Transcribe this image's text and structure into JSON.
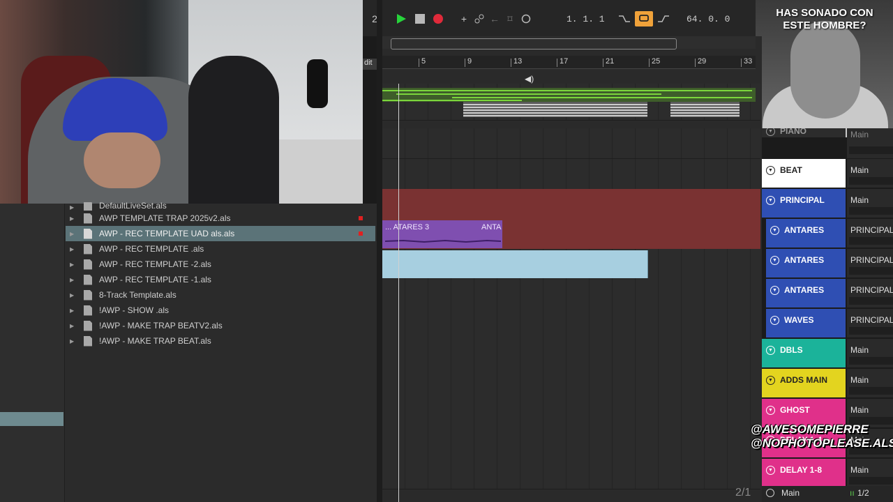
{
  "overlay": {
    "reaction_caption": "HAS SONADO CON ESTE HOMBRE?",
    "handle_1": "@AWESOMEPIERRE",
    "handle_2": "@NOPHOTOPLEASE.ALS"
  },
  "transport": {
    "track_num": "2",
    "position": "1.  1.  1",
    "loop_length": "64.  0.  0",
    "edit_tab": "dit"
  },
  "ruler": {
    "bars": [
      "5",
      "9",
      "13",
      "17",
      "21",
      "25",
      "29",
      "33"
    ]
  },
  "browser": {
    "files": [
      {
        "name": "DefaultLiveSet.als",
        "selected": false,
        "modified": false
      },
      {
        "name": "AWP TEMPLATE TRAP 2025v2.als",
        "selected": false,
        "modified": true
      },
      {
        "name": "AWP - REC TEMPLATE UAD als.als",
        "selected": true,
        "modified": true
      },
      {
        "name": "AWP - REC TEMPLATE .als",
        "selected": false,
        "modified": false
      },
      {
        "name": "AWP - REC TEMPLATE -2.als",
        "selected": false,
        "modified": false
      },
      {
        "name": "AWP - REC TEMPLATE -1.als",
        "selected": false,
        "modified": false
      },
      {
        "name": "8-Track Template.als",
        "selected": false,
        "modified": false
      },
      {
        "name": "!AWP - SHOW .als",
        "selected": false,
        "modified": false
      },
      {
        "name": "!AWP - MAKE TRAP BEATV2.als",
        "selected": false,
        "modified": false
      },
      {
        "name": "!AWP - MAKE TRAP BEAT.als",
        "selected": false,
        "modified": false
      }
    ]
  },
  "clips": {
    "antares_label_1": "... ATARES 3",
    "antares_label_2": "ANTA"
  },
  "tracks": [
    {
      "name": "PIANO",
      "color": "#2c2c2c",
      "text": "#9a9a9a",
      "output": "Main"
    },
    {
      "name": "BEAT",
      "color": "#ffffff",
      "text": "#222222",
      "output": "Main"
    },
    {
      "name": "PRINCIPAL",
      "color": "#2f4fb3",
      "text": "#ffffff",
      "output": "Main"
    },
    {
      "name": "ANTARES",
      "color": "#2f4fb3",
      "text": "#ffffff",
      "output": "PRINCIPAL"
    },
    {
      "name": "ANTARES",
      "color": "#2f4fb3",
      "text": "#ffffff",
      "output": "PRINCIPAL"
    },
    {
      "name": "ANTARES",
      "color": "#2f4fb3",
      "text": "#ffffff",
      "output": "PRINCIPAL"
    },
    {
      "name": "WAVES",
      "color": "#2f4fb3",
      "text": "#ffffff",
      "output": "PRINCIPAL"
    },
    {
      "name": "DBLS",
      "color": "#1bb39a",
      "text": "#ffffff",
      "output": "Main"
    },
    {
      "name": "ADDS MAIN",
      "color": "#e3d41f",
      "text": "#222222",
      "output": "Main"
    },
    {
      "name": "GHOST",
      "color": "#e0308a",
      "text": "#ffffff",
      "output": "Main"
    },
    {
      "name": "DELAY 1-4",
      "color": "#e0308a",
      "text": "#ffffff",
      "output": "Main"
    },
    {
      "name": "DELAY 1-8",
      "color": "#e0308a",
      "text": "#ffffff",
      "output": "Main"
    }
  ],
  "footer": {
    "page": "2/1",
    "main_label": "Main",
    "ratio": "1/2"
  }
}
